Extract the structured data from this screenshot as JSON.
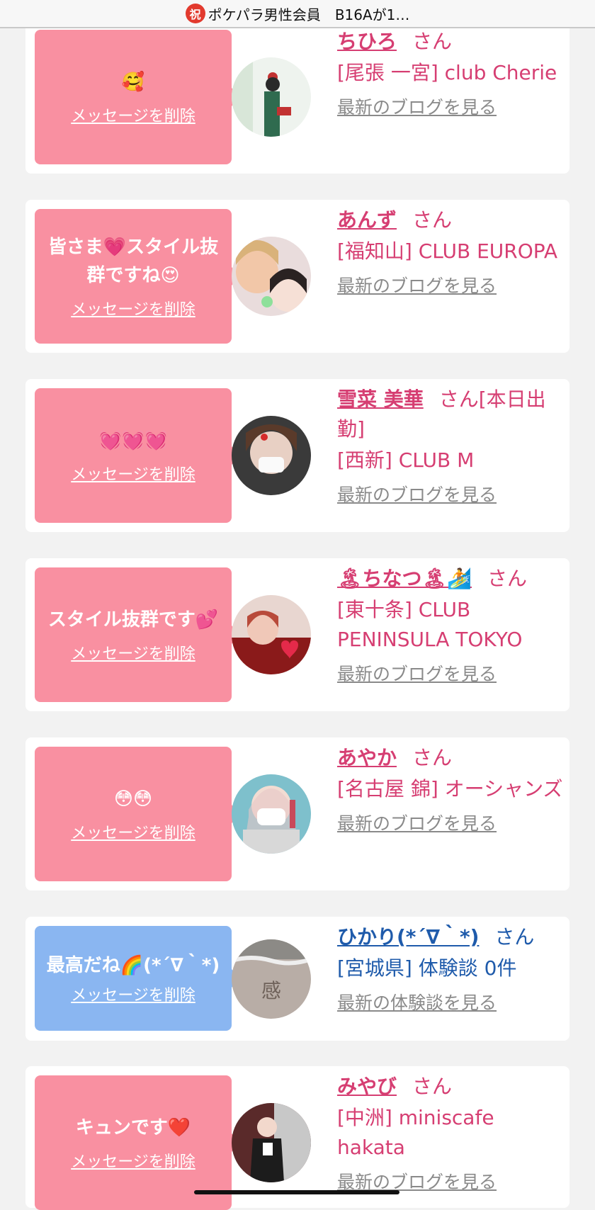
{
  "topbar": {
    "badge": "祝",
    "title": "ポケパラ男性会員",
    "subtitle": "B16Aが1…"
  },
  "cards": [
    {
      "message": "🥰",
      "delete_label": "メッセージを削除",
      "name": "ちひろ",
      "suffix": "さん",
      "shop": "[尾張 一宮] club Cherie",
      "link": "最新のブログを見る",
      "bubble_color": "#f990a1"
    },
    {
      "message": "皆さま💗スタイル抜群ですね😍",
      "delete_label": "メッセージを削除",
      "name": "あんず",
      "suffix": "さん",
      "shop": "[福知山] CLUB EUROPA",
      "link": "最新のブログを見る",
      "bubble_color": "#f990a1"
    },
    {
      "message": "💓💓💓",
      "delete_label": "メッセージを削除",
      "name": "雪菜 美華",
      "suffix": "さん[本日出勤]",
      "shop": "[西新] CLUB M",
      "link": "最新のブログを見る",
      "bubble_color": "#f990a1"
    },
    {
      "message": "スタイル抜群です💕",
      "delete_label": "メッセージを削除",
      "name": "🏝ちなつ🏝🏄",
      "suffix": "さん",
      "shop": "[東十条] CLUB PENINSULA TOKYO",
      "link": "最新のブログを見る",
      "bubble_color": "#f990a1"
    },
    {
      "message": "😳😳",
      "delete_label": "メッセージを削除",
      "name": "あやか",
      "suffix": "さん",
      "shop": "[名古屋 錦] オーシャンズ",
      "link": "最新のブログを見る",
      "bubble_color": "#f990a1"
    },
    {
      "message": "最高だね🌈(*´∇｀*)",
      "delete_label": "メッセージを削除",
      "name": "ひかり(*´∇｀*)",
      "suffix": "さん",
      "shop": "[宮城県] 体験談 0件",
      "link": "最新の体験談を見る",
      "bubble_color": "#8ab6f1"
    },
    {
      "message": "キュンです❤️",
      "delete_label": "メッセージを削除",
      "name": "みやび",
      "suffix": "さん",
      "shop": "[中洲] miniscafe hakata",
      "link": "最新のブログを見る",
      "bubble_color": "#f990a1"
    }
  ]
}
